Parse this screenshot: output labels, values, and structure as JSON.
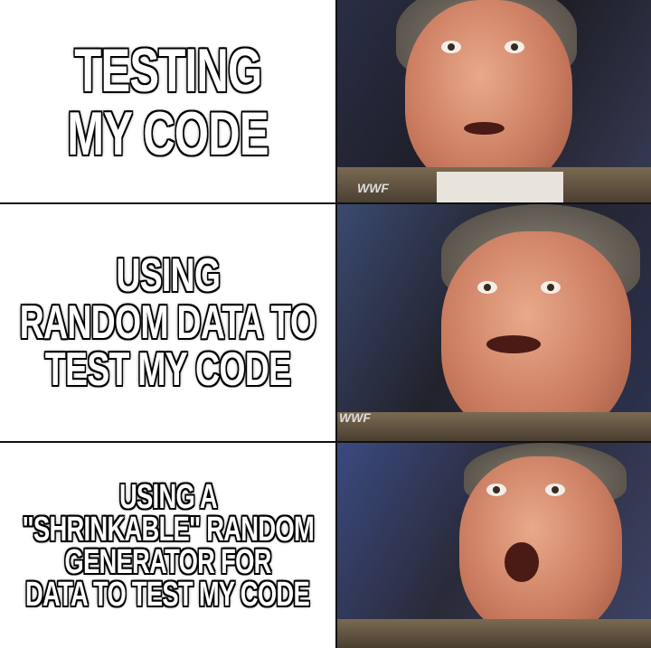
{
  "panels": [
    {
      "lines": [
        "TESTING",
        "MY CODE"
      ]
    },
    {
      "lines": [
        "USING",
        "RANDOM DATA TO",
        "TEST MY CODE"
      ]
    },
    {
      "lines": [
        "USING A",
        "\"SHRINKABLE\" RANDOM",
        "GENERATOR FOR",
        "DATA TO TEST MY CODE"
      ]
    }
  ],
  "logo": "WWF"
}
